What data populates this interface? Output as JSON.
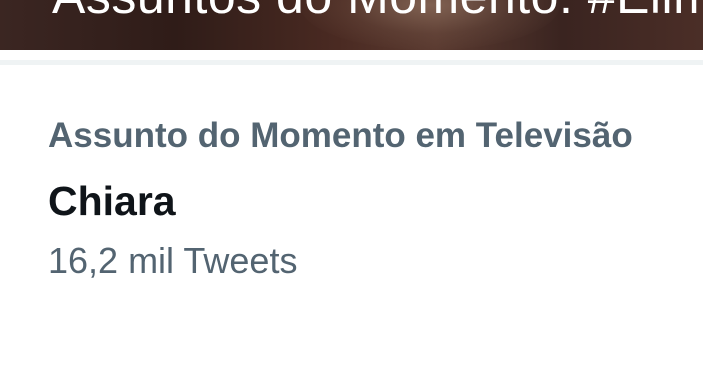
{
  "banner": {
    "text": "Assuntos do Momento: #Elimina"
  },
  "trend": {
    "context": "Assunto do Momento em Televisão",
    "name": "Chiara",
    "count": "16,2 mil Tweets"
  }
}
